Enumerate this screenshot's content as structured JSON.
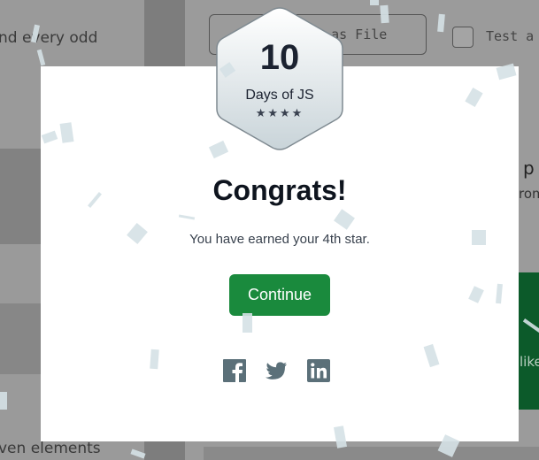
{
  "background": {
    "left_text_top": "nd every odd",
    "left_text_bottom": "ven elements",
    "upload_button_label": "de as File",
    "test_label": "Test a",
    "right_heading_fragment": "p",
    "right_text_fragment": "rom",
    "right_like_fragment": "like"
  },
  "badge": {
    "days": "10",
    "label": "Days of JS",
    "stars": "★★★★"
  },
  "modal": {
    "title": "Congrats!",
    "message": "You have earned your 4th star.",
    "continue_label": "Continue"
  },
  "share": {
    "icons": [
      "facebook-icon",
      "twitter-icon",
      "linkedin-icon"
    ],
    "color": "#5b7079"
  },
  "colors": {
    "accent_green": "#1a8a3d",
    "overlay": "#8e8e8e",
    "confetti": "#d5e1e5"
  }
}
